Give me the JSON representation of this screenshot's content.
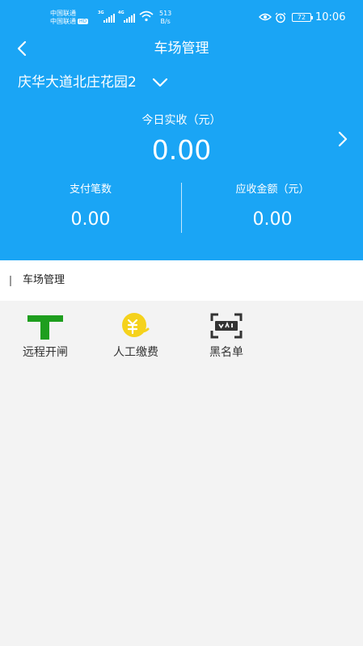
{
  "status_bar": {
    "carrier_1": "中国联通",
    "carrier_2": "中国联通",
    "hd_badge": "HD",
    "signal_1_tag": "3G",
    "signal_2_tag": "4G",
    "net_speed_value": "513",
    "net_speed_unit": "B/s",
    "battery": "72",
    "time": "10:06"
  },
  "nav": {
    "title": "车场管理",
    "back_icon": "chevron-left-icon"
  },
  "lot_selector": {
    "name": "庆华大道北庄花园2",
    "icon": "chevron-down-icon"
  },
  "summary": {
    "today_label": "今日实收（元）",
    "today_value": "0.00",
    "detail_icon": "chevron-right-icon",
    "payments_label": "支付笔数",
    "payments_value": "0.00",
    "receivable_label": "应收金额（元）",
    "receivable_value": "0.00"
  },
  "section": {
    "title": "车场管理"
  },
  "menu": [
    {
      "label": "远程开闸",
      "icon": "remote-gate-icon",
      "color": "#1e9e1e"
    },
    {
      "label": "人工缴费",
      "icon": "manual-payment-icon",
      "color": "#f5d21c"
    },
    {
      "label": "黑名单",
      "icon": "blacklist-plate-scan-icon",
      "color": "#333333"
    }
  ],
  "colors": {
    "header_bg": "#1aa5f5",
    "page_bg": "#f3f3f3"
  }
}
